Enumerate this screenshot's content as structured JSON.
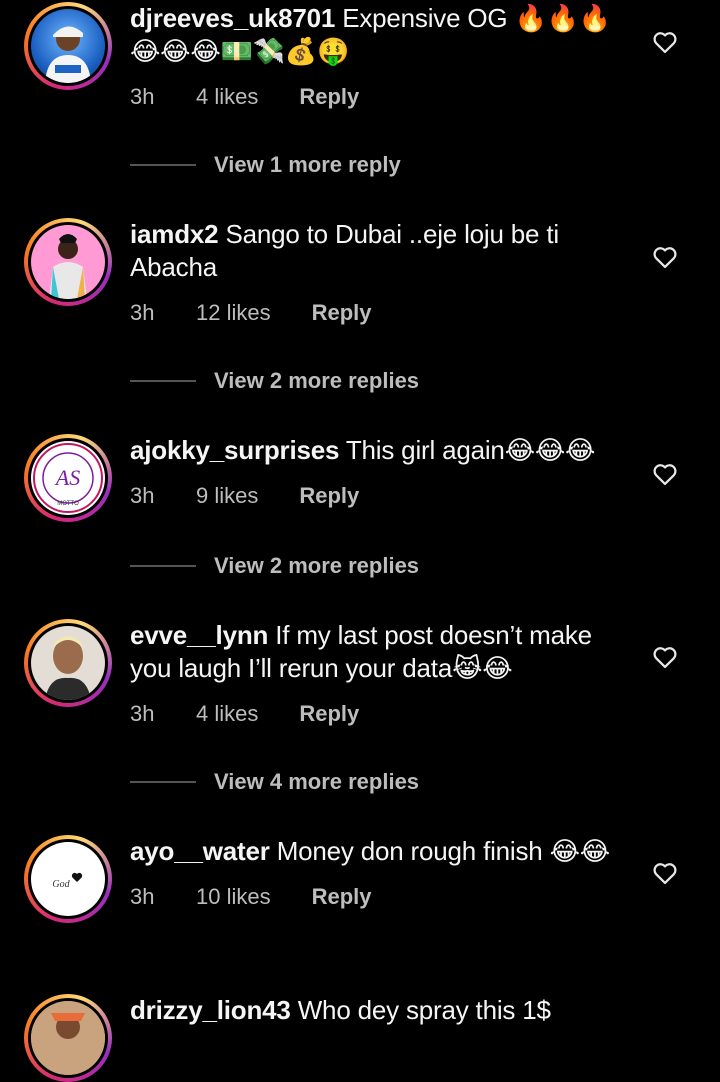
{
  "comments": [
    {
      "username": "djreeves_uk8701",
      "text": "Expensive OG 🔥🔥🔥😂😂😂💵💸💰🤑",
      "time": "3h",
      "likes": "4 likes",
      "reply": "Reply",
      "more": "View 1 more reply",
      "avatar": "man-in-cap-avatar"
    },
    {
      "username": "iamdx2",
      "text": "Sango to Dubai ..eje loju be ti Abacha",
      "time": "3h",
      "likes": "12 likes",
      "reply": "Reply",
      "more": "View 2 more replies",
      "avatar": "person-pink-background-avatar"
    },
    {
      "username": "ajokky_surprises",
      "text": "This girl again😂😂😂",
      "time": "3h",
      "likes": "9 likes",
      "reply": "Reply",
      "more": "View 2 more replies",
      "avatar": "as-logo-avatar",
      "logo_text": "AS",
      "logo_sub": "MOTTO"
    },
    {
      "username": "evve__lynn",
      "text": "If my last post doesn’t make you laugh I’ll rerun your data😹😂",
      "time": "3h",
      "likes": "4 likes",
      "reply": "Reply",
      "more": "View 4 more replies",
      "avatar": "woman-portrait-avatar"
    },
    {
      "username": "ayo__water",
      "text": "Money don rough finish 😂😂",
      "time": "3h",
      "likes": "10 likes",
      "reply": "Reply",
      "avatar": "god-heart-avatar",
      "logo_text": "God"
    },
    {
      "username": "drizzy_lion43",
      "text": "Who dey spray this 1$",
      "avatar": "man-outdoor-avatar"
    }
  ],
  "icons": {
    "like": "heart-outline-icon"
  },
  "colors": {
    "background": "#000000",
    "text": "#f5f5f5",
    "secondary": "#bdbdbd"
  }
}
